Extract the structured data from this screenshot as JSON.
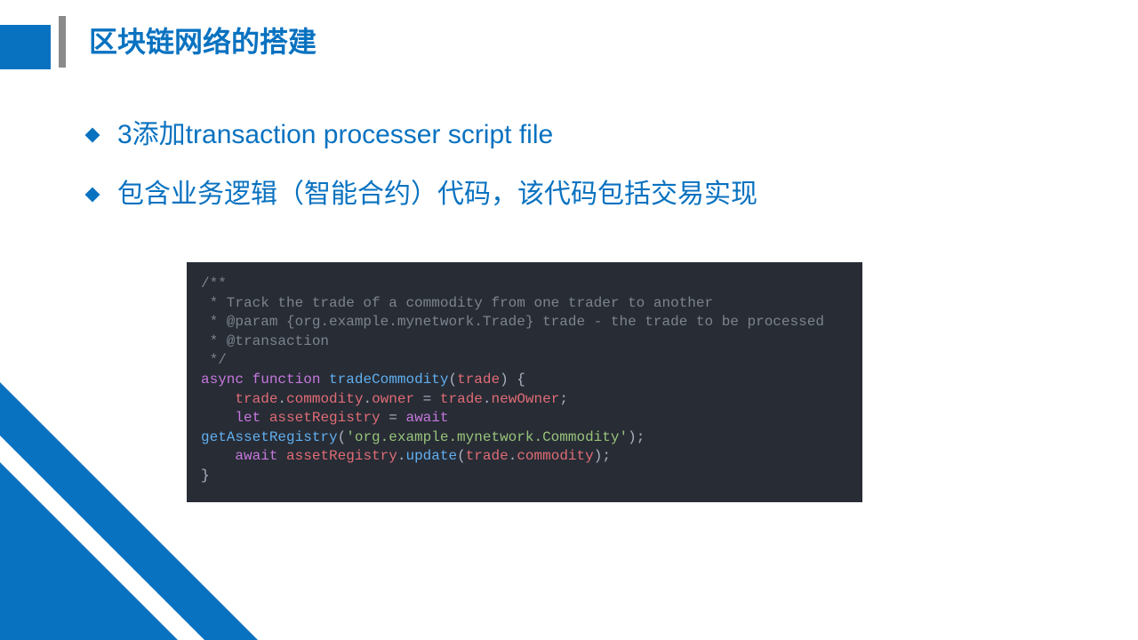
{
  "title": "区块链网络的搭建",
  "bullets": [
    "3添加transaction processer script file",
    "包含业务逻辑（智能合约）代码，该代码包括交易实现"
  ],
  "code": {
    "lines": [
      {
        "segments": [
          {
            "t": "/**",
            "c": "c-comment"
          }
        ]
      },
      {
        "segments": [
          {
            "t": " * Track the trade of a commodity from one trader to another",
            "c": "c-comment"
          }
        ]
      },
      {
        "segments": [
          {
            "t": " * @param {org.example.mynetwork.Trade} trade - the trade to be processed",
            "c": "c-comment"
          }
        ]
      },
      {
        "segments": [
          {
            "t": " * @transaction",
            "c": "c-comment"
          }
        ]
      },
      {
        "segments": [
          {
            "t": " */",
            "c": "c-comment"
          }
        ]
      },
      {
        "segments": [
          {
            "t": "async",
            "c": "c-keyword"
          },
          {
            "t": " ",
            "c": "c-base"
          },
          {
            "t": "function",
            "c": "c-keyword"
          },
          {
            "t": " ",
            "c": "c-base"
          },
          {
            "t": "tradeCommodity",
            "c": "c-func"
          },
          {
            "t": "(",
            "c": "c-punct"
          },
          {
            "t": "trade",
            "c": "c-var"
          },
          {
            "t": ") {",
            "c": "c-punct"
          }
        ]
      },
      {
        "segments": [
          {
            "t": "    ",
            "c": "c-base"
          },
          {
            "t": "trade",
            "c": "c-var"
          },
          {
            "t": ".",
            "c": "c-punct"
          },
          {
            "t": "commodity",
            "c": "c-var"
          },
          {
            "t": ".",
            "c": "c-punct"
          },
          {
            "t": "owner",
            "c": "c-var"
          },
          {
            "t": " = ",
            "c": "c-punct"
          },
          {
            "t": "trade",
            "c": "c-var"
          },
          {
            "t": ".",
            "c": "c-punct"
          },
          {
            "t": "newOwner",
            "c": "c-var"
          },
          {
            "t": ";",
            "c": "c-punct"
          }
        ]
      },
      {
        "segments": [
          {
            "t": "    ",
            "c": "c-base"
          },
          {
            "t": "let",
            "c": "c-keyword"
          },
          {
            "t": " ",
            "c": "c-base"
          },
          {
            "t": "assetRegistry",
            "c": "c-var"
          },
          {
            "t": " = ",
            "c": "c-punct"
          },
          {
            "t": "await",
            "c": "c-keyword"
          }
        ]
      },
      {
        "segments": [
          {
            "t": "getAssetRegistry",
            "c": "c-func"
          },
          {
            "t": "(",
            "c": "c-punct"
          },
          {
            "t": "'org.example.mynetwork.Commodity'",
            "c": "c-string"
          },
          {
            "t": ");",
            "c": "c-punct"
          }
        ]
      },
      {
        "segments": [
          {
            "t": "    ",
            "c": "c-base"
          },
          {
            "t": "await",
            "c": "c-keyword"
          },
          {
            "t": " ",
            "c": "c-base"
          },
          {
            "t": "assetRegistry",
            "c": "c-var"
          },
          {
            "t": ".",
            "c": "c-punct"
          },
          {
            "t": "update",
            "c": "c-func"
          },
          {
            "t": "(",
            "c": "c-punct"
          },
          {
            "t": "trade",
            "c": "c-var"
          },
          {
            "t": ".",
            "c": "c-punct"
          },
          {
            "t": "commodity",
            "c": "c-var"
          },
          {
            "t": ");",
            "c": "c-punct"
          }
        ]
      },
      {
        "segments": [
          {
            "t": "}",
            "c": "c-punct"
          }
        ]
      }
    ]
  }
}
